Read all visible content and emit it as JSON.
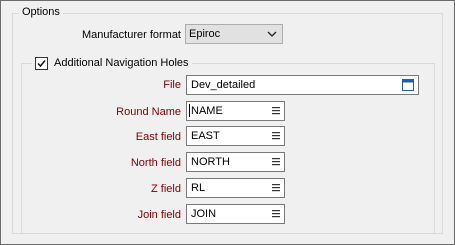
{
  "options": {
    "legend": "Options",
    "manufacturer_format": {
      "label": "Manufacturer format",
      "value": "Epiroc"
    }
  },
  "navigation": {
    "checkbox_label": "Additional Navigation Holes",
    "checked": true,
    "file": {
      "label": "File",
      "value": "Dev_detailed"
    },
    "fields": [
      {
        "label": "Round Name",
        "value": "NAME"
      },
      {
        "label": "East field",
        "value": "EAST"
      },
      {
        "label": "North field",
        "value": "NORTH"
      },
      {
        "label": "Z field",
        "value": "RL"
      },
      {
        "label": "Join field",
        "value": "JOIN"
      }
    ]
  },
  "colors": {
    "field_label": "#800000",
    "background": "#f0f0f0",
    "icon_blue": "#1f5fa8"
  },
  "icons": {
    "combo": "chevron-down-icon",
    "file": "browse-icon",
    "field": "list-icon",
    "checkbox": "checkmark-icon"
  }
}
